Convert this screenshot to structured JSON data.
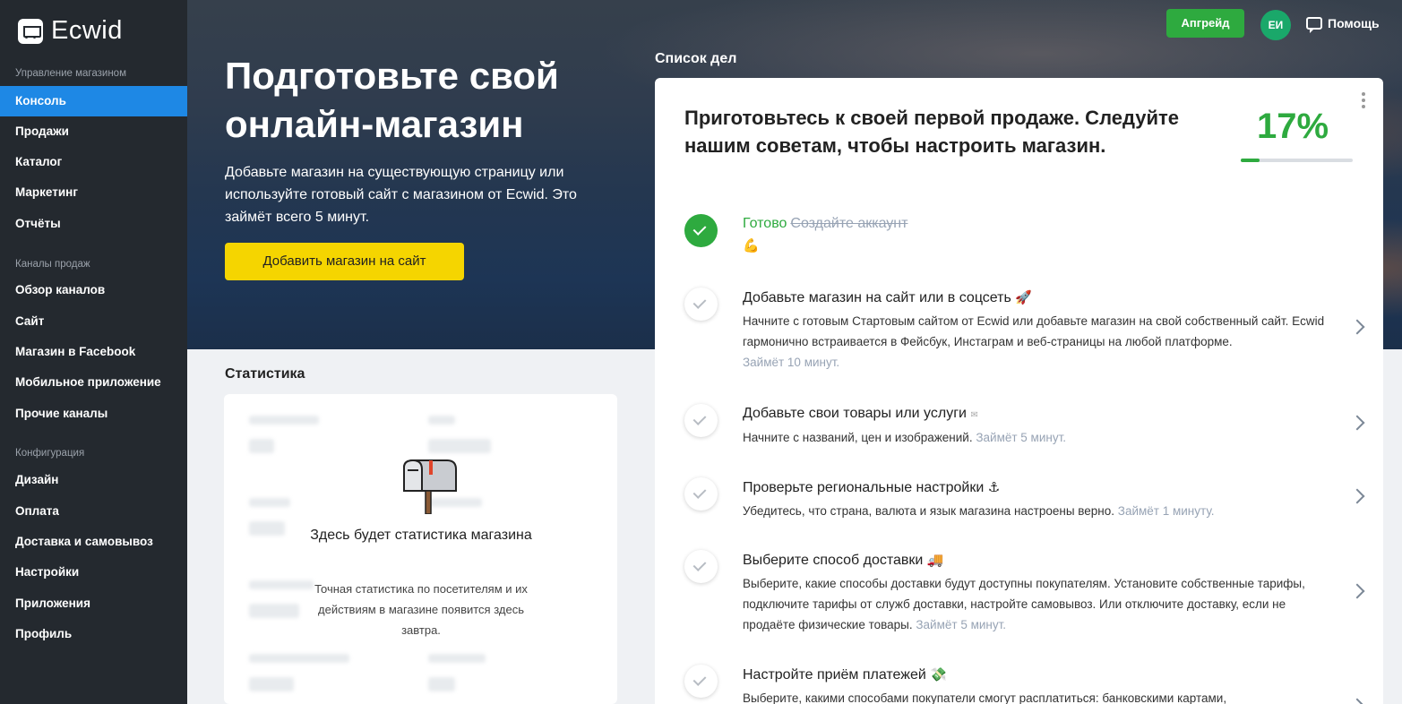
{
  "app": {
    "logo_text": "Ecwid"
  },
  "sidebar": {
    "sections": [
      {
        "label": "Управление магазином"
      },
      {
        "label": "Каналы продаж"
      },
      {
        "label": "Конфигурация"
      }
    ],
    "items": [
      {
        "label": "Консоль",
        "active": true
      },
      {
        "label": "Продажи"
      },
      {
        "label": "Каталог"
      },
      {
        "label": "Маркетинг"
      },
      {
        "label": "Отчёты"
      },
      {
        "label": "Обзор каналов"
      },
      {
        "label": "Сайт"
      },
      {
        "label": "Магазин в Facebook"
      },
      {
        "label": "Мобильное приложение"
      },
      {
        "label": "Прочие каналы"
      },
      {
        "label": "Дизайн"
      },
      {
        "label": "Оплата"
      },
      {
        "label": "Доставка и самовывоз"
      },
      {
        "label": "Настройки"
      },
      {
        "label": "Приложения"
      },
      {
        "label": "Профиль"
      }
    ]
  },
  "topbar": {
    "upgrade_label": "Апгрейд",
    "avatar_initials": "ЕИ",
    "help_label": "Помощь"
  },
  "hero": {
    "title": "Подготовьте свой онлайн-магазин",
    "subtitle": "Добавьте магазин на существующую страницу или используйте готовый сайт с магазином от Ecwid. Это займёт всего 5 минут.",
    "button_label": "Добавить магазин на сайт"
  },
  "stats": {
    "heading": "Статистика",
    "empty_title": "Здесь будет статистика магазина",
    "empty_text": "Точная статистика по посетителям и их действиям в магазине появится здесь завтра."
  },
  "todo": {
    "heading": "Список дел",
    "title": "Приготовьтесь к своей первой продаже. Следуйте нашим советам, чтобы настроить магазин.",
    "percent": "17%",
    "progress_fraction": 0.17,
    "done_task": {
      "status": "Готово",
      "title": "Создайте аккаунт",
      "emoji": "💪"
    },
    "tasks": [
      {
        "title": "Добавьте магазин на сайт или в соцсеть",
        "emoji": "🚀",
        "desc": "Начните с готовым Стартовым сайтом от Ecwid или добавьте магазин на свой собственный сайт. Ecwid гармонично встраивается в Фейсбук, Инстаграм и веб-страницы на любой платформе.",
        "time": "Займёт 10 минут."
      },
      {
        "title": "Добавьте свои товары или услуги",
        "emoji": "✉",
        "desc": "Начните с названий, цен и изображений.",
        "time": "Займёт 5 минут."
      },
      {
        "title": "Проверьте региональные настройки",
        "emoji": "⚓",
        "desc": "Убедитесь, что страна, валюта и язык магазина настроены верно.",
        "time": "Займёт 1 минуту."
      },
      {
        "title": "Выберите способ доставки",
        "emoji": "🚚",
        "desc": "Выберите, какие способы доставки будут доступны покупателям. Установите собственные тарифы, подключите тарифы от служб доставки, настройте самовывоз. Или отключите доставку, если не продаёте физические товары.",
        "time": "Займёт 5 минут."
      },
      {
        "title": "Настройте приём платежей",
        "emoji": "💸",
        "desc": "Выберите, какими способами покупатели смогут расплатиться: банковскими картами,",
        "time": ""
      }
    ]
  },
  "colors": {
    "accent": "#1e88e5",
    "green": "#2eaa3f",
    "yellow": "#f5d500",
    "sidebar": "#24292f"
  },
  "icons": [
    "cart-logo-icon",
    "help-chat-icon",
    "kebab-menu-icon",
    "check-icon",
    "chevron-right-icon",
    "mailbox-icon"
  ]
}
